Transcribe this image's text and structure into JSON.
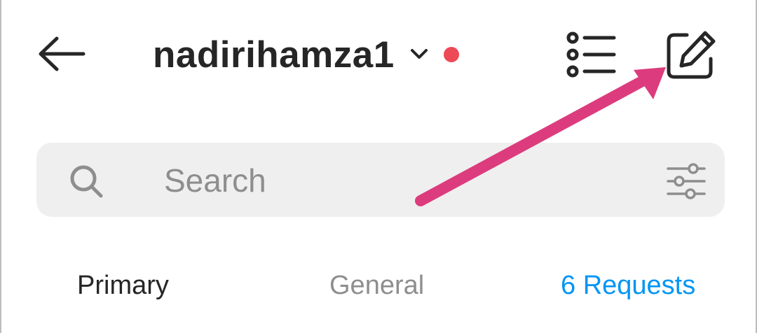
{
  "header": {
    "title": "nadirihamza1",
    "back_icon": "arrow-left-icon",
    "chevron_icon": "chevron-down-icon",
    "list_icon": "list-icon",
    "compose_icon": "compose-icon",
    "notification_dot_color": "#ed4956"
  },
  "search": {
    "placeholder": "Search",
    "value": "",
    "search_icon": "search-icon",
    "filter_icon": "filter-sliders-icon"
  },
  "tabs": [
    {
      "label": "Primary",
      "color": "#262626"
    },
    {
      "label": "General",
      "color": "#8e8e8e"
    },
    {
      "label": "6 Requests",
      "color": "#0095f6"
    }
  ],
  "annotation": {
    "arrow_color": "#dc3c7d"
  }
}
